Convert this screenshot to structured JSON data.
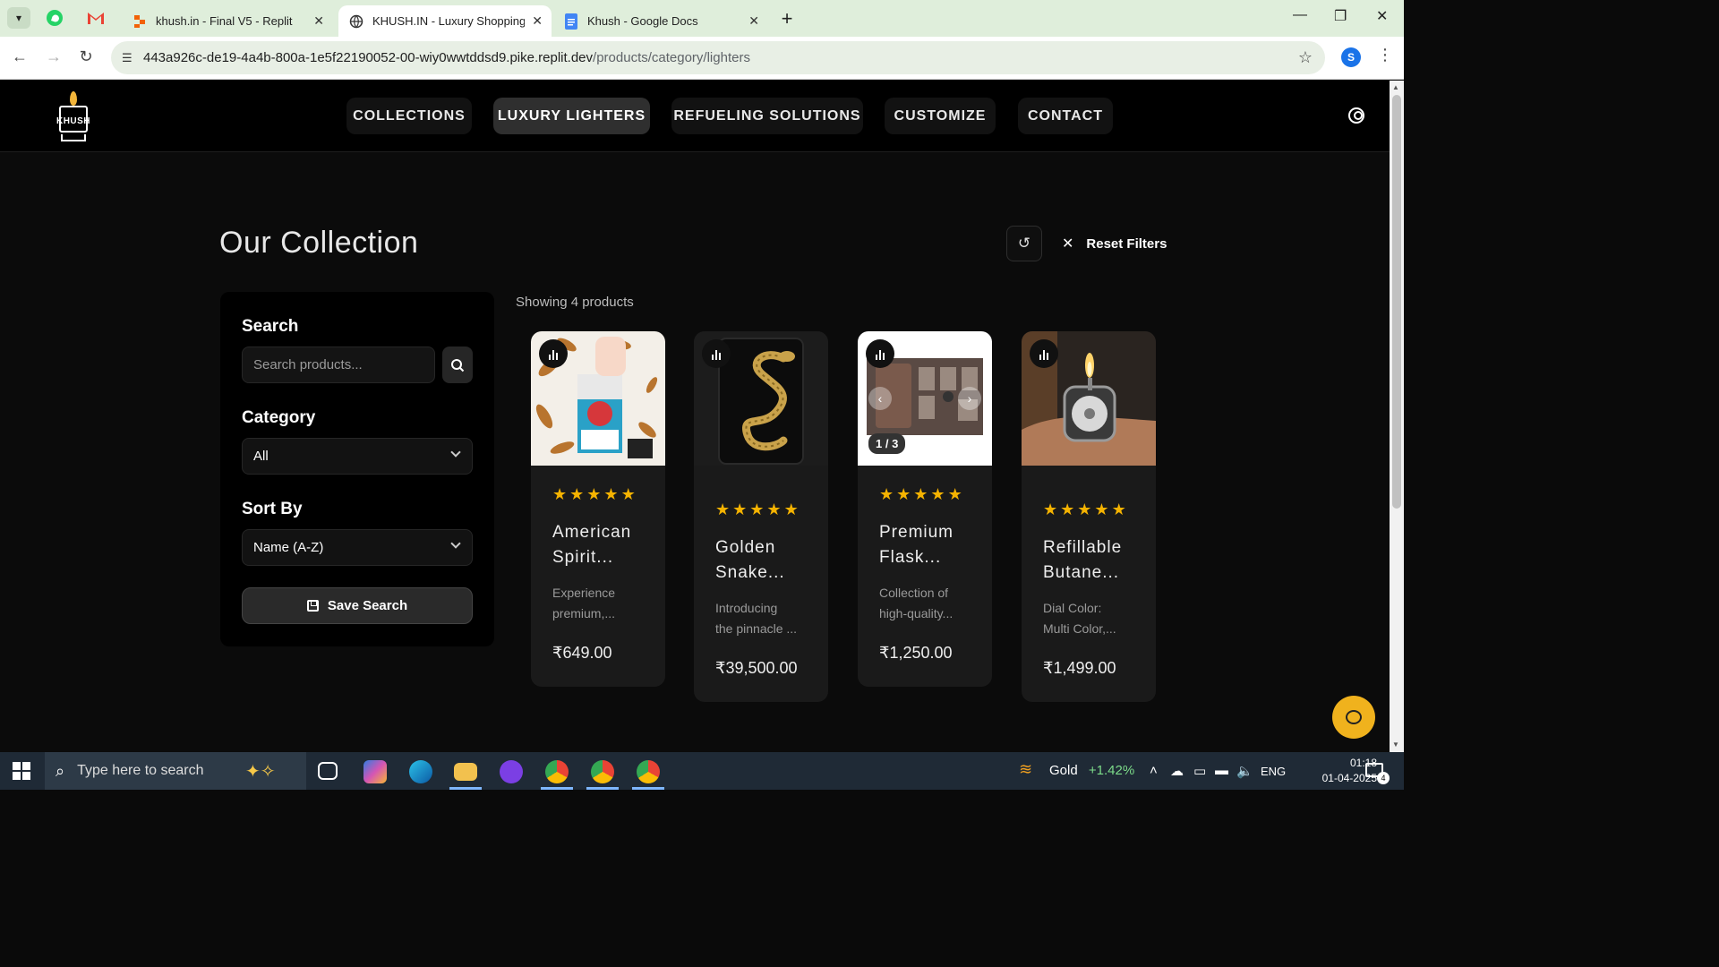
{
  "browser": {
    "tabs": [
      {
        "title": "khush.in - Final V5 - Replit",
        "active": false
      },
      {
        "title": "KHUSH.IN - Luxury Shopping Ex",
        "active": true
      },
      {
        "title": "Khush - Google Docs",
        "active": false
      }
    ],
    "url_host": "443a926c-de19-4a4b-800a-1e5f22190052-00-wiy0wwtddsd9.pike.replit.dev",
    "url_path": "/products/category/lighters",
    "profile_initial": "S"
  },
  "site": {
    "logo_text": "KHUSH",
    "nav": [
      {
        "label": "COLLECTIONS",
        "active": false
      },
      {
        "label": "LUXURY LIGHTERS",
        "active": true
      },
      {
        "label": "REFUELING SOLUTIONS",
        "active": false
      },
      {
        "label": "CUSTOMIZE",
        "active": false
      },
      {
        "label": "CONTACT",
        "active": false
      }
    ],
    "page_title": "Our Collection",
    "reset_filters": "Reset Filters",
    "sidebar": {
      "search_label": "Search",
      "search_placeholder": "Search products...",
      "category_label": "Category",
      "category_value": "All",
      "sort_label": "Sort By",
      "sort_value": "Name (A-Z)",
      "save_search": "Save Search"
    },
    "showing_text": "Showing 4 products",
    "products": [
      {
        "title_l1": "American",
        "title_l2": "Spirit...",
        "desc_l1": "Experience",
        "desc_l2": "premium,...",
        "price": "₹649.00",
        "rating": 5
      },
      {
        "title_l1": "Golden",
        "title_l2": "Snake...",
        "desc_l1": "Introducing",
        "desc_l2": "the pinnacle ...",
        "price": "₹39,500.00",
        "rating": 5
      },
      {
        "title_l1": "Premium",
        "title_l2": "Flask...",
        "desc_l1": "Collection of",
        "desc_l2": "high-quality...",
        "price": "₹1,250.00",
        "rating": 5,
        "slide_counter": "1 / 3"
      },
      {
        "title_l1": "Refillable",
        "title_l2": "Butane...",
        "desc_l1": "Dial Color:",
        "desc_l2": "Multi Color,...",
        "price": "₹1,499.00",
        "rating": 5
      }
    ],
    "star_glyph": "★",
    "accent_color": "#f0b21d"
  },
  "taskbar": {
    "search_placeholder": "Type here to search",
    "widget_label": "Gold",
    "widget_value": "+1.42%",
    "language": "ENG",
    "time": "01:18",
    "date": "01-04-2025",
    "notification_count": "4"
  }
}
